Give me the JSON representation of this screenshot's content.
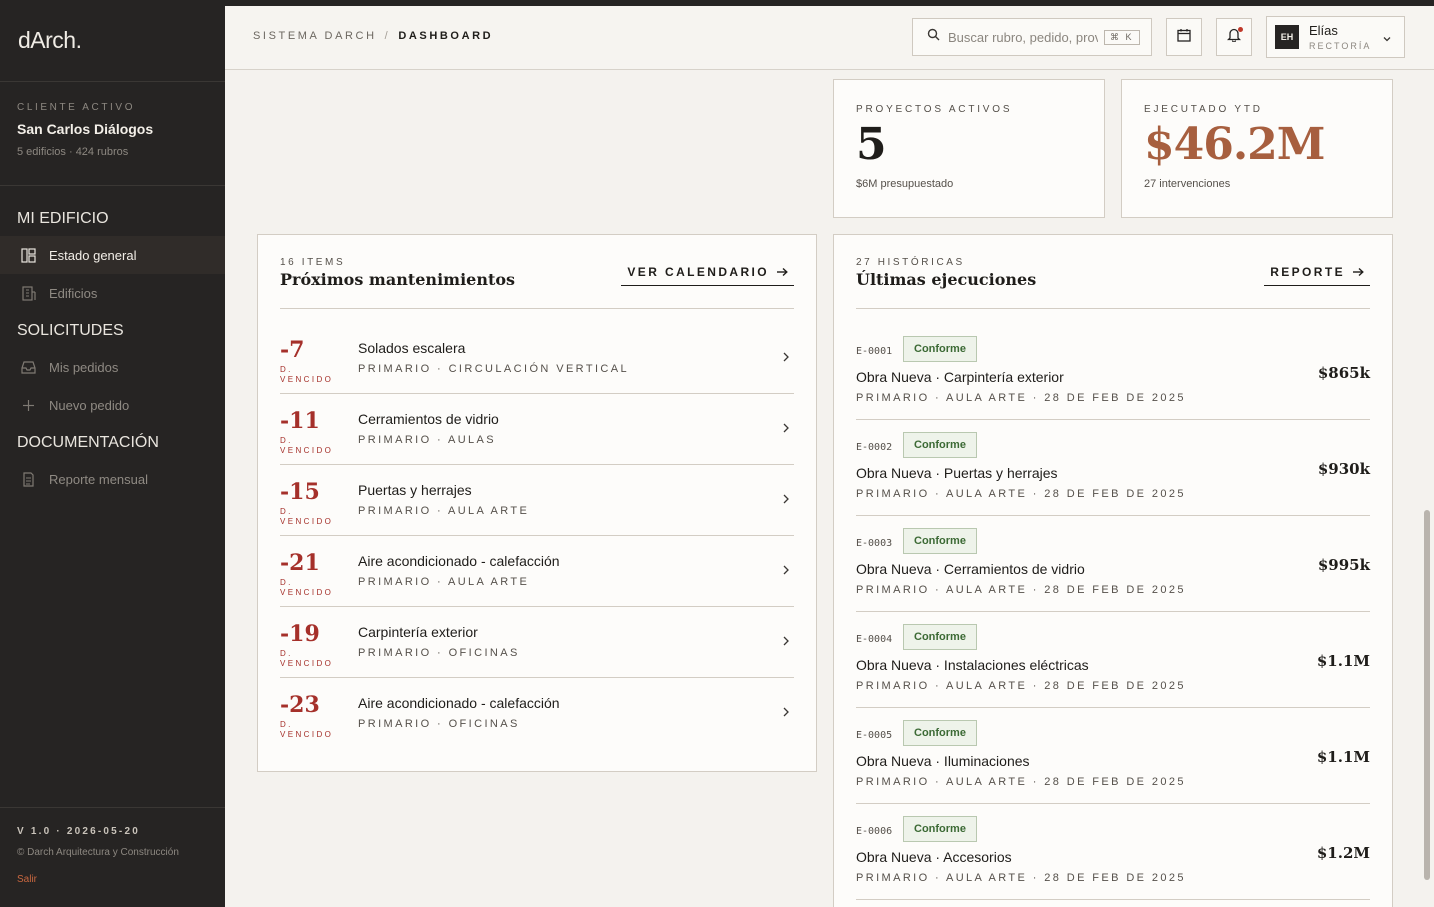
{
  "sidebar": {
    "logo": "dArch.",
    "client_label": "CLIENTE ACTIVO",
    "client_name": "San Carlos Diálogos",
    "client_meta": "5 edificios · 424 rubros",
    "sections": [
      {
        "label": "MI EDIFICIO",
        "items": [
          {
            "label": "Estado general",
            "icon": "grid-icon",
            "active": true
          },
          {
            "label": "Edificios",
            "icon": "building-icon",
            "active": false
          }
        ]
      },
      {
        "label": "SOLICITUDES",
        "items": [
          {
            "label": "Mis pedidos",
            "icon": "inbox-icon",
            "active": false
          },
          {
            "label": "Nuevo pedido",
            "icon": "plus-icon",
            "active": false
          }
        ]
      },
      {
        "label": "DOCUMENTACIÓN",
        "items": [
          {
            "label": "Reporte mensual",
            "icon": "document-icon",
            "active": false
          }
        ]
      }
    ],
    "version": "V 1.0 · 2026-05-20",
    "copyright": "© Darch Arquitectura y Construcción",
    "logout": "Salir"
  },
  "topbar": {
    "breadcrumb_root": "SISTEMA DARCH",
    "breadcrumb_sep": "/",
    "breadcrumb_current": "DASHBOARD",
    "search_placeholder": "Buscar rubro, pedido, proveedor",
    "search_shortcut": "⌘ K",
    "user_initials": "EH",
    "user_name": "Elías",
    "user_role": "RECTORÍA",
    "has_notifications": true
  },
  "kpis": [
    {
      "label": "PROYECTOS ACTIVOS",
      "value": "5",
      "sub": "$6M presupuestado",
      "accent": false
    },
    {
      "label": "EJECUTADO YTD",
      "value": "$46.2M",
      "sub": "27 intervenciones",
      "accent": true
    }
  ],
  "maintenance": {
    "count": "16 ITEMS",
    "title": "Próximos mantenimientos",
    "link": "VER CALENDARIO",
    "items": [
      {
        "days": "-7",
        "state": "D. VENCIDO",
        "name": "Solados escalera",
        "category": "PRIMARIO · CIRCULACIÓN VERTICAL"
      },
      {
        "days": "-11",
        "state": "D. VENCIDO",
        "name": "Cerramientos de vidrio",
        "category": "PRIMARIO · AULAS"
      },
      {
        "days": "-15",
        "state": "D. VENCIDO",
        "name": "Puertas y herrajes",
        "category": "PRIMARIO · AULA ARTE"
      },
      {
        "days": "-21",
        "state": "D. VENCIDO",
        "name": "Aire acondicionado - calefacción",
        "category": "PRIMARIO · AULA ARTE"
      },
      {
        "days": "-19",
        "state": "D. VENCIDO",
        "name": "Carpintería exterior",
        "category": "PRIMARIO · OFICINAS"
      },
      {
        "days": "-23",
        "state": "D. VENCIDO",
        "name": "Aire acondicionado - calefacción",
        "category": "PRIMARIO · OFICINAS"
      }
    ]
  },
  "executions": {
    "count": "27 HISTÓRICAS",
    "title": "Últimas ejecuciones",
    "link": "REPORTE",
    "items": [
      {
        "code": "E-0001",
        "status": "Conforme",
        "name": "Obra Nueva · Carpintería exterior",
        "meta": "PRIMARIO · AULA ARTE · 28 DE FEB DE 2025",
        "amount": "$865k"
      },
      {
        "code": "E-0002",
        "status": "Conforme",
        "name": "Obra Nueva · Puertas y herrajes",
        "meta": "PRIMARIO · AULA ARTE · 28 DE FEB DE 2025",
        "amount": "$930k"
      },
      {
        "code": "E-0003",
        "status": "Conforme",
        "name": "Obra Nueva · Cerramientos de vidrio",
        "meta": "PRIMARIO · AULA ARTE · 28 DE FEB DE 2025",
        "amount": "$995k"
      },
      {
        "code": "E-0004",
        "status": "Conforme",
        "name": "Obra Nueva · Instalaciones eléctricas",
        "meta": "PRIMARIO · AULA ARTE · 28 DE FEB DE 2025",
        "amount": "$1.1M"
      },
      {
        "code": "E-0005",
        "status": "Conforme",
        "name": "Obra Nueva · Iluminaciones",
        "meta": "PRIMARIO · AULA ARTE · 28 DE FEB DE 2025",
        "amount": "$1.1M"
      },
      {
        "code": "E-0006",
        "status": "Conforme",
        "name": "Obra Nueva · Accesorios",
        "meta": "PRIMARIO · AULA ARTE · 28 DE FEB DE 2025",
        "amount": "$1.2M"
      }
    ]
  },
  "colors": {
    "sidebar_bg": "#262423",
    "accent": "#a75f3f",
    "overdue": "#a5302a",
    "status_ok": "#3c6a35"
  }
}
